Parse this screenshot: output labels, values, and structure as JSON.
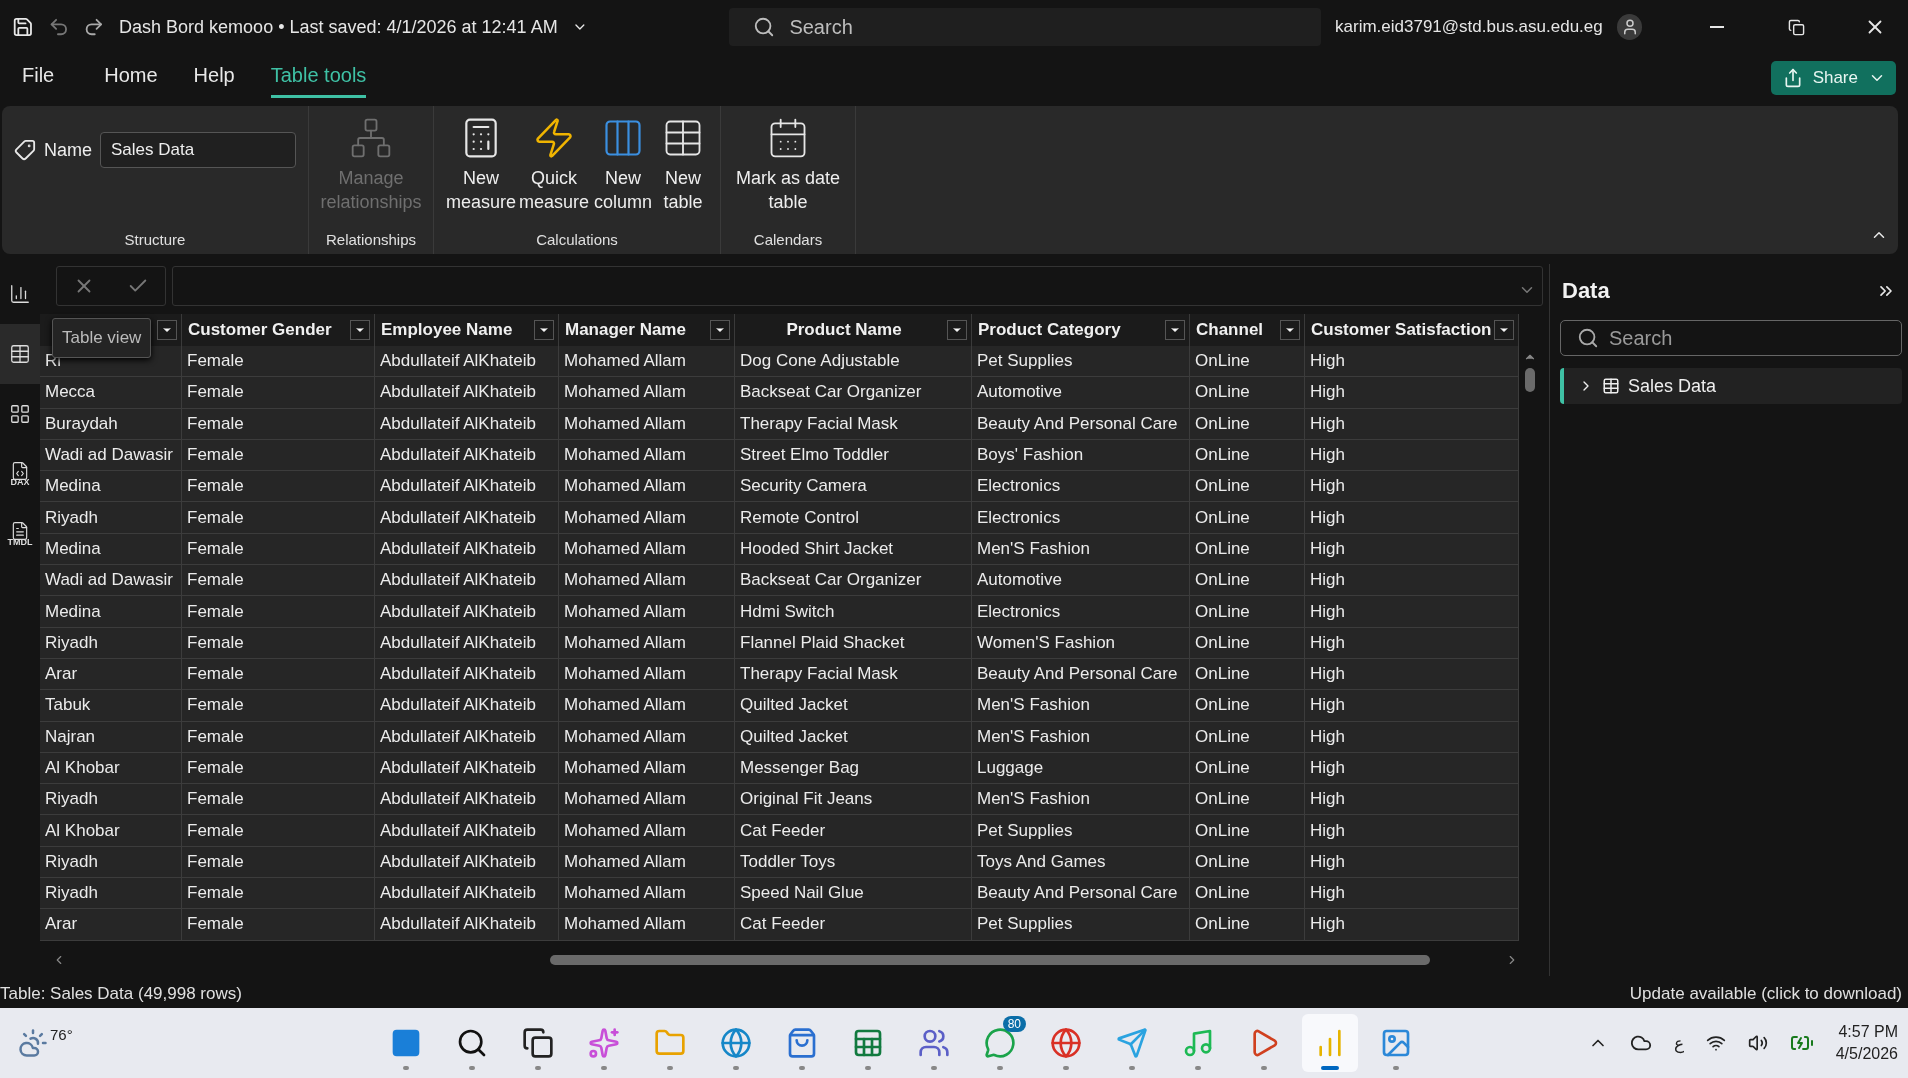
{
  "title_bar": {
    "document_title": "Dash Bord kemooo • Last saved: 4/1/2026 at 12:41 AM",
    "search_placeholder": "Search",
    "account": "karim.eid3791@std.bus.asu.edu.eg"
  },
  "menu_tabs": [
    {
      "label": "File",
      "selected": false
    },
    {
      "label": "Home",
      "selected": false
    },
    {
      "label": "Help",
      "selected": false
    },
    {
      "label": "Table tools",
      "selected": true
    }
  ],
  "share_button": "Share",
  "ribbon": {
    "groups": [
      {
        "name": "Structure",
        "items": [
          {
            "kind": "name_field",
            "label": "Name",
            "value": "Sales Data"
          }
        ]
      },
      {
        "name": "Relationships",
        "items": [
          {
            "kind": "manage",
            "label": "Manage relationships",
            "disabled": true
          }
        ]
      },
      {
        "name": "Calculations",
        "items": [
          {
            "kind": "measure",
            "label": "New measure",
            "disabled": false
          },
          {
            "kind": "quick",
            "label": "Quick measure",
            "disabled": false
          },
          {
            "kind": "column",
            "label": "New column",
            "disabled": false
          },
          {
            "kind": "table",
            "label": "New table",
            "disabled": false
          }
        ]
      },
      {
        "name": "Calendars",
        "items": [
          {
            "kind": "date",
            "label": "Mark as date table",
            "disabled": false
          }
        ]
      }
    ]
  },
  "left_rail": [
    {
      "kind": "report",
      "selected": false
    },
    {
      "kind": "table",
      "selected": true
    },
    {
      "kind": "model",
      "selected": false
    },
    {
      "kind": "dax",
      "label": "DAX",
      "selected": false
    },
    {
      "kind": "tmdl",
      "label": "TMDL",
      "selected": false
    }
  ],
  "tooltip": "Table view",
  "table": {
    "columns": [
      {
        "kind": "covered"
      },
      {
        "kind": "text",
        "label": "Customer Gender"
      },
      {
        "kind": "text",
        "label": "Employee Name"
      },
      {
        "kind": "text",
        "label": "Manager Name"
      },
      {
        "kind": "text",
        "label": "Product Name"
      },
      {
        "kind": "text",
        "label": "Product Category"
      },
      {
        "kind": "text",
        "label": "Channel"
      },
      {
        "kind": "text",
        "label": "Customer Satisfaction"
      }
    ],
    "rows": [
      [
        "Ri",
        "Female",
        "Abdullateif AlKhateib",
        "Mohamed Allam",
        "Dog Cone Adjustable",
        "Pet Supplies",
        "OnLine",
        "High"
      ],
      [
        "Mecca",
        "Female",
        "Abdullateif AlKhateib",
        "Mohamed Allam",
        "Backseat Car Organizer",
        "Automotive",
        "OnLine",
        "High"
      ],
      [
        "Buraydah",
        "Female",
        "Abdullateif AlKhateib",
        "Mohamed Allam",
        "Therapy Facial Mask",
        "Beauty And Personal Care",
        "OnLine",
        "High"
      ],
      [
        "Wadi ad Dawasir",
        "Female",
        "Abdullateif AlKhateib",
        "Mohamed Allam",
        "Street Elmo Toddler",
        "Boys' Fashion",
        "OnLine",
        "High"
      ],
      [
        "Medina",
        "Female",
        "Abdullateif AlKhateib",
        "Mohamed Allam",
        "Security Camera",
        "Electronics",
        "OnLine",
        "High"
      ],
      [
        "Riyadh",
        "Female",
        "Abdullateif AlKhateib",
        "Mohamed Allam",
        "Remote Control",
        "Electronics",
        "OnLine",
        "High"
      ],
      [
        "Medina",
        "Female",
        "Abdullateif AlKhateib",
        "Mohamed Allam",
        "Hooded Shirt Jacket",
        "Men'S Fashion",
        "OnLine",
        "High"
      ],
      [
        "Wadi ad Dawasir",
        "Female",
        "Abdullateif AlKhateib",
        "Mohamed Allam",
        "Backseat Car Organizer",
        "Automotive",
        "OnLine",
        "High"
      ],
      [
        "Medina",
        "Female",
        "Abdullateif AlKhateib",
        "Mohamed Allam",
        "Hdmi Switch",
        "Electronics",
        "OnLine",
        "High"
      ],
      [
        "Riyadh",
        "Female",
        "Abdullateif AlKhateib",
        "Mohamed Allam",
        "Flannel Plaid Shacket",
        "Women'S Fashion",
        "OnLine",
        "High"
      ],
      [
        "Arar",
        "Female",
        "Abdullateif AlKhateib",
        "Mohamed Allam",
        "Therapy Facial Mask",
        "Beauty And Personal Care",
        "OnLine",
        "High"
      ],
      [
        "Tabuk",
        "Female",
        "Abdullateif AlKhateib",
        "Mohamed Allam",
        "Quilted Jacket",
        "Men'S Fashion",
        "OnLine",
        "High"
      ],
      [
        "Najran",
        "Female",
        "Abdullateif AlKhateib",
        "Mohamed Allam",
        "Quilted Jacket",
        "Men'S Fashion",
        "OnLine",
        "High"
      ],
      [
        "Al Khobar",
        "Female",
        "Abdullateif AlKhateib",
        "Mohamed Allam",
        "Messenger Bag",
        "Luggage",
        "OnLine",
        "High"
      ],
      [
        "Riyadh",
        "Female",
        "Abdullateif AlKhateib",
        "Mohamed Allam",
        "Original Fit Jeans",
        "Men'S Fashion",
        "OnLine",
        "High"
      ],
      [
        "Al Khobar",
        "Female",
        "Abdullateif AlKhateib",
        "Mohamed Allam",
        "Cat Feeder",
        "Pet Supplies",
        "OnLine",
        "High"
      ],
      [
        "Riyadh",
        "Female",
        "Abdullateif AlKhateib",
        "Mohamed Allam",
        "Toddler Toys",
        "Toys And Games",
        "OnLine",
        "High"
      ],
      [
        "Riyadh",
        "Female",
        "Abdullateif AlKhateib",
        "Mohamed Allam",
        "Speed Nail Glue",
        "Beauty And Personal Care",
        "OnLine",
        "High"
      ],
      [
        "Arar",
        "Female",
        "Abdullateif AlKhateib",
        "Mohamed Allam",
        "Cat Feeder",
        "Pet Supplies",
        "OnLine",
        "High"
      ]
    ]
  },
  "data_pane": {
    "title": "Data",
    "search_placeholder": "Search",
    "tables": [
      {
        "name": "Sales Data",
        "expanded": false,
        "selected": true
      }
    ]
  },
  "status_bar": {
    "left": "Table: Sales Data (49,998 rows)",
    "right": "Update available (click to download)"
  },
  "taskbar": {
    "weather": "76°",
    "apps": [
      {
        "kind": "windows",
        "selected": false
      },
      {
        "kind": "search",
        "selected": false
      },
      {
        "kind": "taskview",
        "selected": false
      },
      {
        "kind": "copilot",
        "selected": false
      },
      {
        "kind": "files",
        "selected": false
      },
      {
        "kind": "edge",
        "selected": false
      },
      {
        "kind": "store",
        "selected": false
      },
      {
        "kind": "excel",
        "selected": false
      },
      {
        "kind": "teams",
        "selected": false
      },
      {
        "kind": "whatsapp",
        "badge": "80",
        "selected": false
      },
      {
        "kind": "chrome",
        "selected": false
      },
      {
        "kind": "telegram",
        "selected": false
      },
      {
        "kind": "spotify",
        "selected": false
      },
      {
        "kind": "player",
        "selected": false
      },
      {
        "kind": "powerbi",
        "selected": true
      },
      {
        "kind": "photos",
        "selected": false
      }
    ],
    "language": "ع",
    "time": "4:57 PM",
    "date": "4/5/2026"
  }
}
